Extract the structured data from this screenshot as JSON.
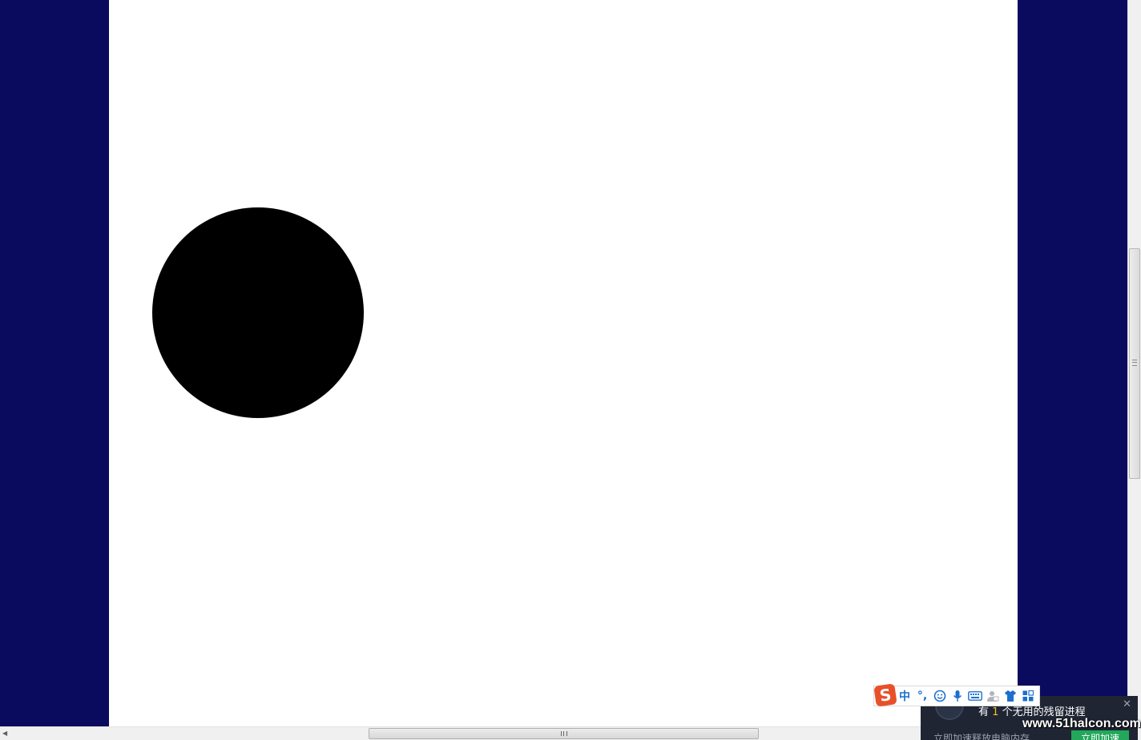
{
  "colors": {
    "background": "#0a0a5e",
    "canvas": "#ffffff",
    "blob": "#000000",
    "ime_accent": "#1b6fd0",
    "ime_logo": "#e8502a",
    "notify_bg": "#1f2533",
    "notify_button": "#22a75b",
    "notify_highlight": "#f3c020"
  },
  "ime_toolbar": {
    "logo": "S",
    "mode_label": "中",
    "punct_label": "°,",
    "icons": [
      "sogou-logo-icon",
      "emoji-icon",
      "microphone-icon",
      "keyboard-icon",
      "user-icon",
      "skin-shirt-icon",
      "toolbox-icon"
    ]
  },
  "notification": {
    "prefix": "有",
    "count": "1",
    "suffix": "个无用的残留进程",
    "subtext": "立即加速释放电脑内存",
    "button": "立即加速",
    "close": "✕"
  },
  "watermark": "www.51halcon.com",
  "scrollbars": {
    "horizontal_arrow": "◀"
  }
}
